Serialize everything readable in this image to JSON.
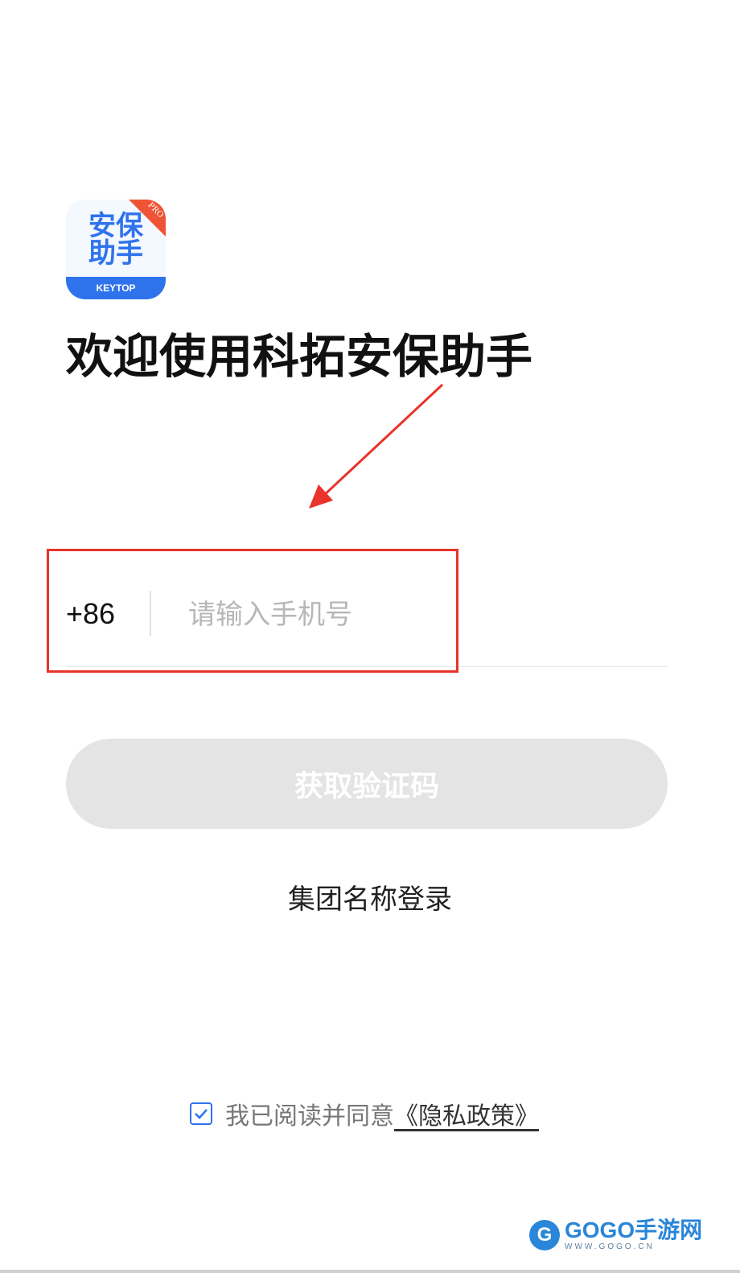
{
  "logo": {
    "line1": "安保",
    "line2": "助手",
    "band_text": "KEYTOP",
    "badge": "PRO",
    "brand_color": "#2f73ec",
    "badge_color": "#ef5336"
  },
  "title": "欢迎使用科拓安保助手",
  "phone": {
    "country_code": "+86",
    "placeholder": "请输入手机号",
    "value": ""
  },
  "get_code_button": "获取验证码",
  "group_login_link": "集团名称登录",
  "agreement": {
    "checked": true,
    "text": "我已阅读并同意",
    "link": "《隐私政策》"
  },
  "watermark": {
    "icon_letter": "G",
    "title": "GOGO手游网",
    "url": "WWW.GOGO.CN"
  },
  "annotation": {
    "color": "#e8342a",
    "icon": "arrow-pointer-icon"
  }
}
